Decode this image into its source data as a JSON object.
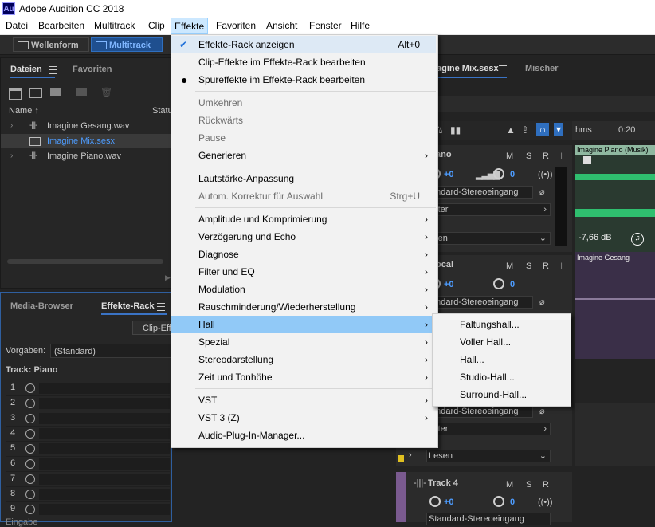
{
  "titlebar": {
    "icon": "Au",
    "title": "Adobe Audition CC 2018"
  },
  "menubar": {
    "items": [
      "Datei",
      "Bearbeiten",
      "Multitrack",
      "Clip",
      "Effekte",
      "Favoriten",
      "Ansicht",
      "Fenster",
      "Hilfe"
    ],
    "active": "Effekte"
  },
  "toolbar": {
    "wellenform": "Wellenform",
    "multitrack": "Multitrack"
  },
  "files_panel": {
    "tabs": [
      "Dateien",
      "Favoriten"
    ],
    "col_name": "Name",
    "col_status": "Statu",
    "files": [
      {
        "name": "Imagine Gesang.wav",
        "selected": false
      },
      {
        "name": "Imagine Mix.sesx",
        "selected": true
      },
      {
        "name": "Imagine Piano.wav",
        "selected": false
      }
    ]
  },
  "rack_panel": {
    "tabs": [
      "Media-Browser",
      "Effekte-Rack"
    ],
    "clip_button": "Clip-Eff",
    "presets_label": "Vorgaben:",
    "presets_value": "(Standard)",
    "track_label": "Track: Piano",
    "slots": [
      "1",
      "2",
      "3",
      "4",
      "5",
      "6",
      "7",
      "8",
      "9"
    ],
    "bottom_partial": "Eingabe"
  },
  "editor": {
    "tab_title": "agine Mix.sesx",
    "tab_mixer": "Mischer",
    "ruler_unit": "hms",
    "ruler_mark": "0:20",
    "track1": {
      "name": "ano",
      "clip": "Imagine Piano (Musik)",
      "m": "M",
      "s": "S",
      "r": "R",
      "i": "I",
      "vol": "+0",
      "pan": "0",
      "input": "tandard-Stereoeingang",
      "output": "aster",
      "read": "esen",
      "gain": "-7,66 dB"
    },
    "track2": {
      "name": "ocal",
      "clip": "Imagine Gesang",
      "m": "M",
      "s": "S",
      "r": "R",
      "i": "I",
      "vol": "+0",
      "pan": "0",
      "input": "tandard-Stereoeingang"
    },
    "track3": {
      "input": "tandard-Stereoeingang",
      "output": "aster",
      "read": "Lesen"
    },
    "track4": {
      "name": "Track 4",
      "m": "M",
      "s": "S",
      "r": "R",
      "vol": "+0",
      "pan": "0",
      "input": "Standard-Stereoeingang"
    }
  },
  "effects_menu": {
    "items": [
      {
        "label": "Effekte-Rack anzeigen",
        "shortcut": "Alt+0",
        "mark": "check",
        "state": "normal"
      },
      {
        "label": "Clip-Effekte im Effekte-Rack bearbeiten",
        "state": "normal"
      },
      {
        "label": "Spureffekte im Effekte-Rack bearbeiten",
        "mark": "dot",
        "state": "normal"
      },
      {
        "label": "Umkehren",
        "state": "disabled"
      },
      {
        "label": "Rückwärts",
        "state": "disabled"
      },
      {
        "label": "Pause",
        "state": "disabled"
      },
      {
        "label": "Generieren",
        "arrow": true,
        "state": "normal"
      },
      {
        "label": "Lautstärke-Anpassung",
        "state": "normal"
      },
      {
        "label": "Autom. Korrektur für Auswahl",
        "shortcut": "Strg+U",
        "state": "disabled"
      },
      {
        "label": "Amplitude und Komprimierung",
        "arrow": true,
        "state": "normal"
      },
      {
        "label": "Verzögerung und Echo",
        "arrow": true,
        "state": "normal"
      },
      {
        "label": "Diagnose",
        "arrow": true,
        "state": "normal"
      },
      {
        "label": "Filter und EQ",
        "arrow": true,
        "state": "normal"
      },
      {
        "label": "Modulation",
        "arrow": true,
        "state": "normal"
      },
      {
        "label": "Rauschminderung/Wiederherstellung",
        "arrow": true,
        "state": "normal"
      },
      {
        "label": "Hall",
        "arrow": true,
        "state": "highlighted"
      },
      {
        "label": "Spezial",
        "arrow": true,
        "state": "normal"
      },
      {
        "label": "Stereodarstellung",
        "arrow": true,
        "state": "normal"
      },
      {
        "label": "Zeit und Tonhöhe",
        "arrow": true,
        "state": "normal"
      },
      {
        "label": "VST",
        "arrow": true,
        "state": "normal"
      },
      {
        "label": "VST 3 (Z)",
        "arrow": true,
        "state": "normal"
      },
      {
        "label": "Audio-Plug-In-Manager...",
        "state": "normal"
      }
    ]
  },
  "hall_submenu": {
    "items": [
      "Faltungshall...",
      "Voller Hall...",
      "Hall...",
      "Studio-Hall...",
      "Surround-Hall..."
    ]
  },
  "colors": {
    "accent": "#3a73c5",
    "highlight": "#91c9f7",
    "menubar_active": "#cce8ff",
    "wave_green": "#2fbf6f",
    "track_purple": "#7a5a8f"
  }
}
